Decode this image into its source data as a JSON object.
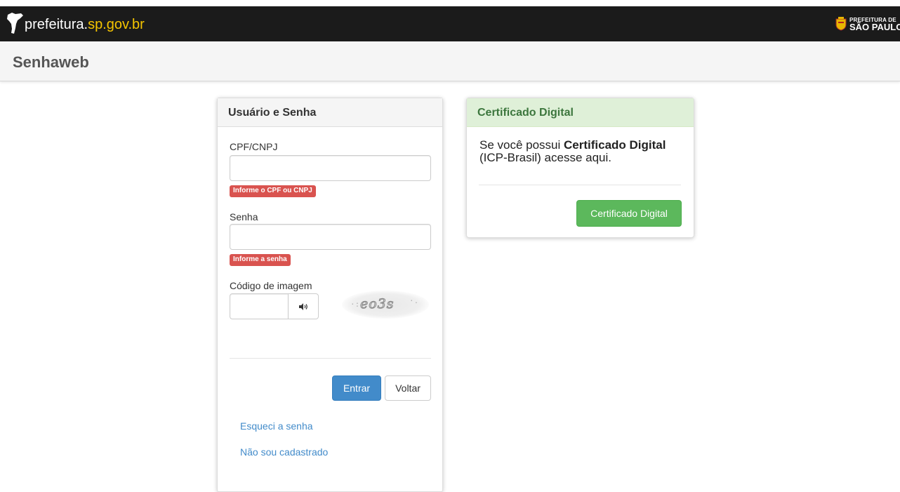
{
  "header": {
    "site_name_prefix": "prefeitura.",
    "site_name_accent": "sp.gov.br",
    "brand_line1": "PREFEITURA DE",
    "brand_line2": "SÃO PAULO",
    "logo_icon": "sp-map-icon"
  },
  "subheader": {
    "title": "Senhaweb"
  },
  "login_panel": {
    "title": "Usuário e Senha",
    "cpf_label": "CPF/CNPJ",
    "cpf_value": "",
    "cpf_error": "Informe o CPF ou CNPJ",
    "password_label": "Senha",
    "password_value": "",
    "password_error": "Informe a senha",
    "captcha_label": "Código de imagem",
    "captcha_value": "",
    "captcha_audio_icon": "speaker-icon",
    "captcha_text": "eo3s",
    "submit_label": "Entrar",
    "back_label": "Voltar",
    "forgot_link": "Esqueci a senha",
    "register_link": "Não sou cadastrado"
  },
  "cert_panel": {
    "title": "Certificado Digital",
    "text_1": "Se você possui ",
    "text_bold": "Certificado Digital",
    "text_2": " (ICP-Brasil) acesse aqui.",
    "button_label": "Certificado Digital"
  },
  "colors": {
    "topbar_bg": "#1b1b1b",
    "accent_yellow": "#f5c400",
    "primary": "#428bca",
    "success": "#5cb85c",
    "danger": "#d9534f",
    "cert_header_bg": "#dff0d8",
    "cert_header_text": "#3c763d"
  }
}
